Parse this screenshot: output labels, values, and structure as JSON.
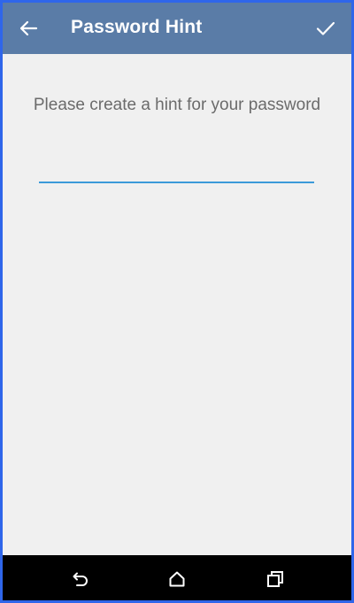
{
  "header": {
    "title": "Password Hint",
    "back_icon": "arrow-left-icon",
    "confirm_icon": "check-icon"
  },
  "main": {
    "prompt": "Please create a hint for your password",
    "hint_input": {
      "value": "",
      "placeholder": ""
    }
  },
  "navbar": {
    "back_icon": "nav-back-icon",
    "home_icon": "nav-home-icon",
    "recents_icon": "nav-recents-icon"
  },
  "colors": {
    "appbar": "#5a7ca7",
    "background": "#f0f0f0",
    "accent": "#3b9ad9",
    "frame": "#2f66ea"
  }
}
